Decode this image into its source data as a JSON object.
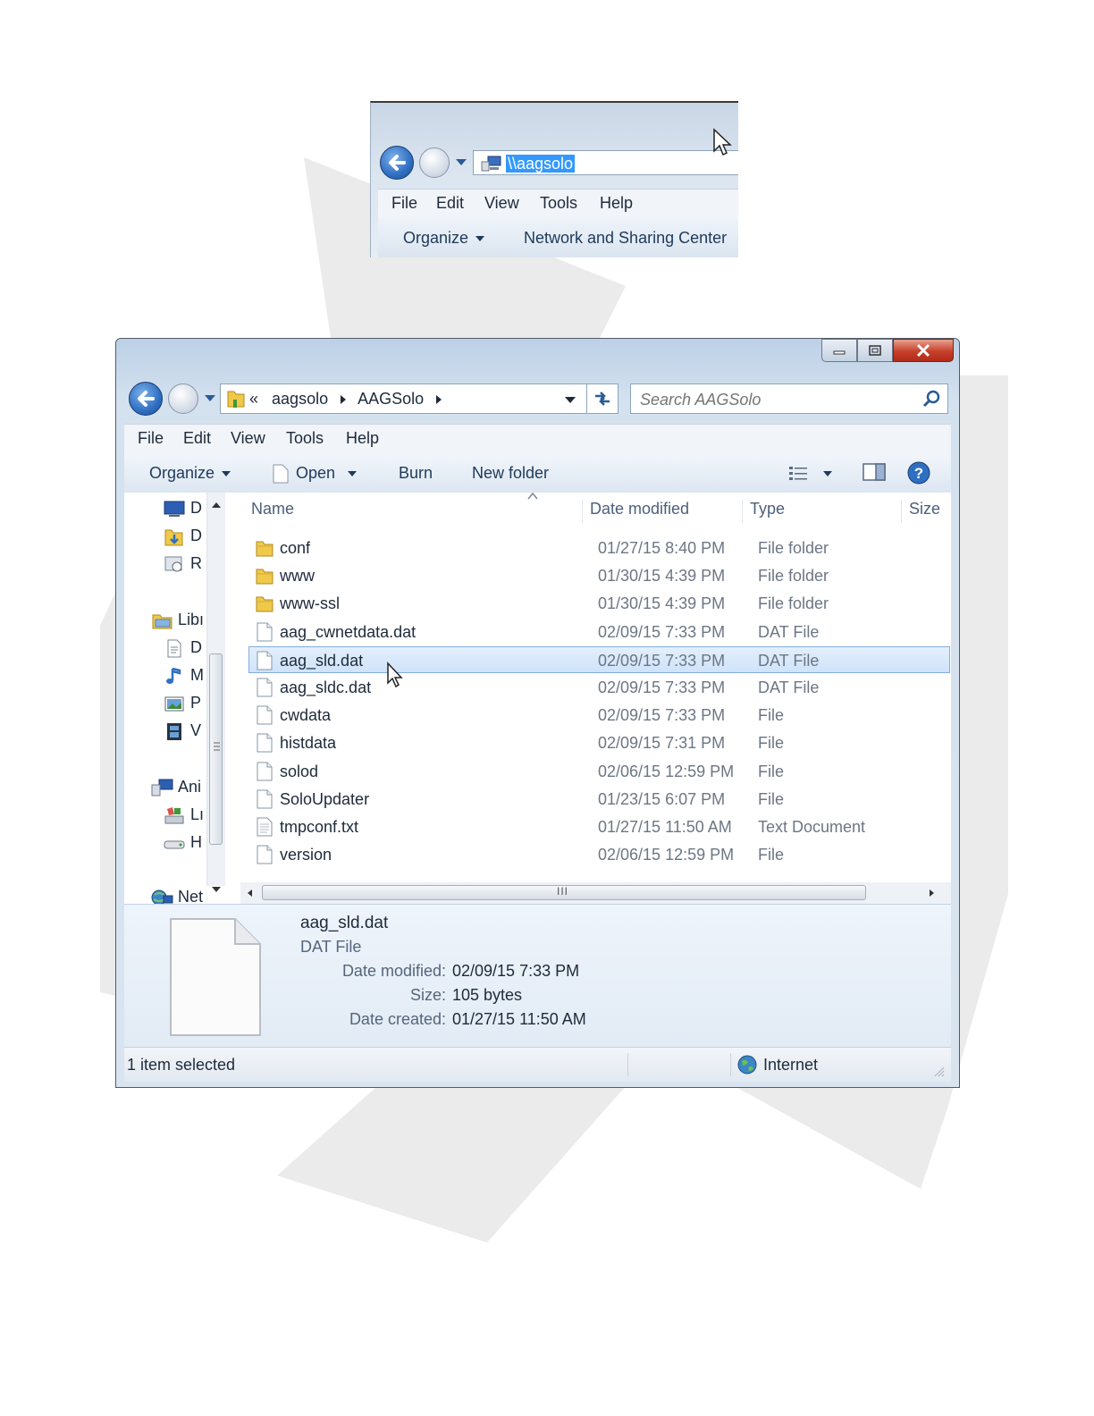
{
  "snippet": {
    "address_text": "\\\\aagsolo",
    "menu": [
      "File",
      "Edit",
      "View",
      "Tools",
      "Help"
    ],
    "toolbar": {
      "organize": "Organize",
      "network_center": "Network and Sharing Center"
    }
  },
  "window": {
    "breadcrumb": {
      "overflow": "«",
      "items": [
        "aagsolo",
        "AAGSolo"
      ]
    },
    "search_placeholder": "Search AAGSolo",
    "menu": [
      "File",
      "Edit",
      "View",
      "Tools",
      "Help"
    ],
    "toolbar": {
      "organize": "Organize",
      "open": "Open",
      "burn": "Burn",
      "new_folder": "New folder"
    },
    "nav_pane": [
      "D",
      "D",
      "R",
      "Libı",
      "D",
      "M",
      "P",
      "V",
      "Ani",
      "Lı",
      "H",
      "Net"
    ],
    "columns": {
      "name": "Name",
      "date": "Date modified",
      "type": "Type",
      "size": "Size"
    },
    "files": [
      {
        "name": "conf",
        "date": "01/27/15 8:40 PM",
        "type": "File folder",
        "icon": "folder-icon"
      },
      {
        "name": "www",
        "date": "01/30/15 4:39 PM",
        "type": "File folder",
        "icon": "folder-icon"
      },
      {
        "name": "www-ssl",
        "date": "01/30/15 4:39 PM",
        "type": "File folder",
        "icon": "folder-icon"
      },
      {
        "name": "aag_cwnetdata.dat",
        "date": "02/09/15 7:33 PM",
        "type": "DAT File",
        "icon": "file-icon"
      },
      {
        "name": "aag_sld.dat",
        "date": "02/09/15 7:33 PM",
        "type": "DAT File",
        "icon": "file-icon",
        "selected": true
      },
      {
        "name": "aag_sldc.dat",
        "date": "02/09/15 7:33 PM",
        "type": "DAT File",
        "icon": "file-icon"
      },
      {
        "name": "cwdata",
        "date": "02/09/15 7:33 PM",
        "type": "File",
        "icon": "file-icon"
      },
      {
        "name": "histdata",
        "date": "02/09/15 7:31 PM",
        "type": "File",
        "icon": "file-icon"
      },
      {
        "name": "solod",
        "date": "02/06/15 12:59 PM",
        "type": "File",
        "icon": "file-icon"
      },
      {
        "name": "SoloUpdater",
        "date": "01/23/15 6:07 PM",
        "type": "File",
        "icon": "file-icon"
      },
      {
        "name": "tmpconf.txt",
        "date": "01/27/15 11:50 AM",
        "type": "Text Document",
        "icon": "text-file-icon"
      },
      {
        "name": "version",
        "date": "02/06/15 12:59 PM",
        "type": "File",
        "icon": "file-icon"
      }
    ],
    "scroll_grip": "III",
    "details": {
      "name": "aag_sld.dat",
      "type": "DAT File",
      "date_modified_label": "Date modified:",
      "date_modified": "02/09/15 7:33 PM",
      "size_label": "Size:",
      "size": "105 bytes",
      "date_created_label": "Date created:",
      "date_created": "01/27/15 11:50 AM"
    },
    "status": {
      "selection": "1 item selected",
      "zone": "Internet"
    }
  },
  "colors": {
    "selection": "#3399ff",
    "row_selected": "#cfe3fa",
    "close_button": "#c6402a"
  }
}
